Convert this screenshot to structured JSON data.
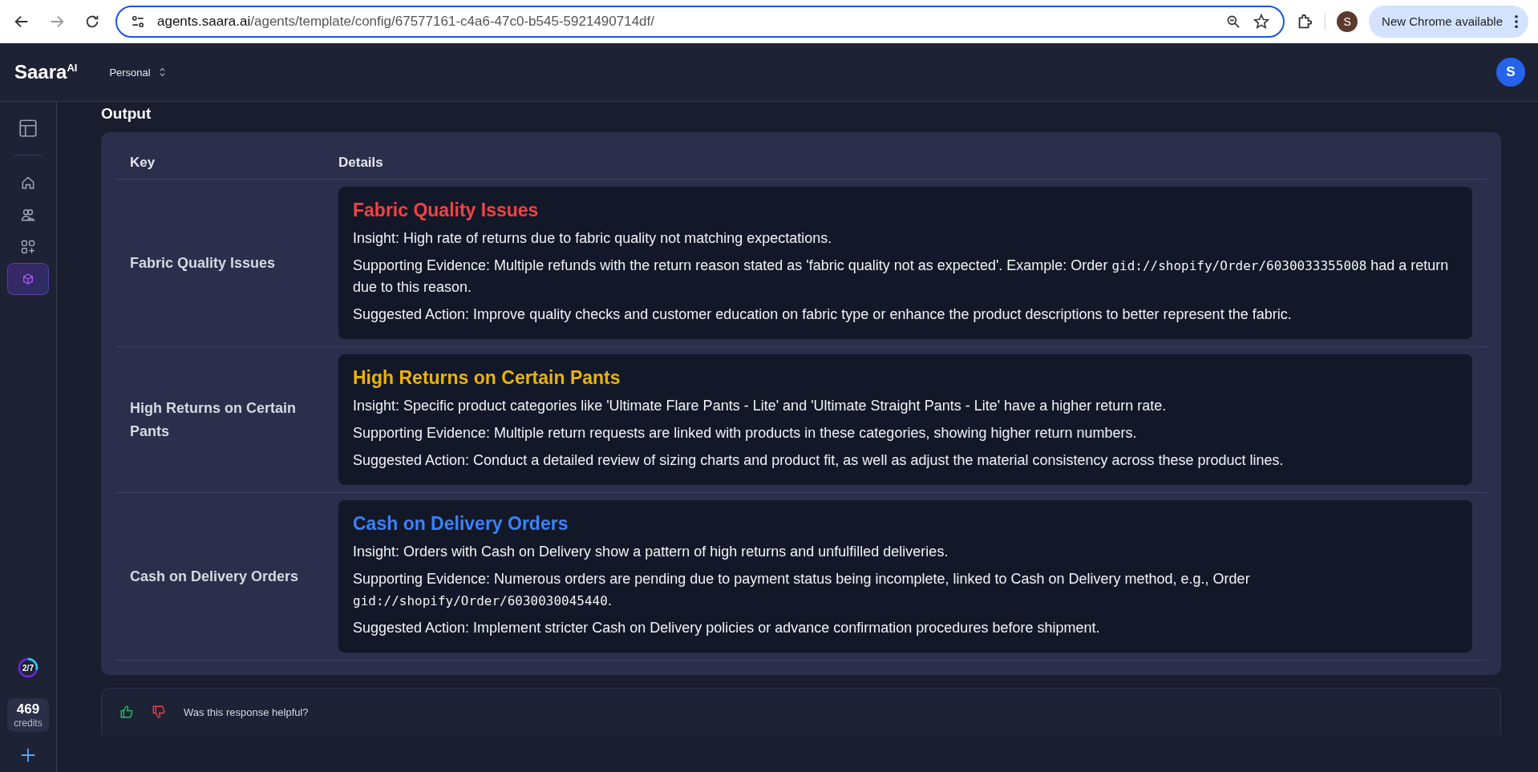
{
  "browser": {
    "url_host": "agents.saara.ai",
    "url_path": "/agents/template/config/67577161-c4a6-47c0-b545-5921490714df/",
    "profile_initial": "S",
    "update_label": "New Chrome available"
  },
  "header": {
    "logo": "Saara",
    "logo_sup": "AI",
    "workspace": "Personal",
    "avatar_initial": "S"
  },
  "sidebar": {
    "items": [
      {
        "kind": "home",
        "selected": false
      },
      {
        "kind": "people",
        "selected": false
      },
      {
        "kind": "apps",
        "selected": false
      },
      {
        "kind": "cube",
        "selected": true
      }
    ],
    "progress": {
      "label": "2/7",
      "level": 0.2857
    },
    "credits": {
      "count": "469",
      "label": "credits"
    }
  },
  "output": {
    "title": "Output",
    "columns": [
      "Key",
      "Details"
    ],
    "rows": [
      {
        "key": "Fabric Quality Issues",
        "title": "Fabric Quality Issues",
        "color": "#ef4444",
        "paragraphs": [
          [
            {
              "kind": "text",
              "text": "Insight: High rate of returns due to fabric quality not matching expectations."
            }
          ],
          [
            {
              "kind": "text",
              "text": "Supporting Evidence: Multiple refunds with the return reason stated as 'fabric quality not as expected'. Example: Order "
            },
            {
              "kind": "code",
              "text": "gid://shopify/Order/6030033355008"
            },
            {
              "kind": "text",
              "text": " had a return due to this reason."
            }
          ],
          [
            {
              "kind": "text",
              "text": "Suggested Action: Improve quality checks and customer education on fabric type or enhance the product descriptions to better represent the fabric."
            }
          ]
        ]
      },
      {
        "key": "High Returns on Certain Pants",
        "title": "High Returns on Certain Pants",
        "color": "#eab308",
        "paragraphs": [
          [
            {
              "kind": "text",
              "text": "Insight: Specific product categories like 'Ultimate Flare Pants - Lite' and 'Ultimate Straight Pants - Lite' have a higher return rate."
            }
          ],
          [
            {
              "kind": "text",
              "text": "Supporting Evidence: Multiple return requests are linked with products in these categories, showing higher return numbers."
            }
          ],
          [
            {
              "kind": "text",
              "text": "Suggested Action: Conduct a detailed review of sizing charts and product fit, as well as adjust the material consistency across these product lines."
            }
          ]
        ]
      },
      {
        "key": "Cash on Delivery Orders",
        "title": "Cash on Delivery Orders",
        "color": "#3b82f6",
        "paragraphs": [
          [
            {
              "kind": "text",
              "text": "Insight: Orders with Cash on Delivery show a pattern of high returns and unfulfilled deliveries."
            }
          ],
          [
            {
              "kind": "text",
              "text": "Supporting Evidence: Numerous orders are pending due to payment status being incomplete, linked to Cash on Delivery method, e.g., Order "
            },
            {
              "kind": "code",
              "text": "gid://shopify/Order/6030030045440"
            },
            {
              "kind": "text",
              "text": "."
            }
          ],
          [
            {
              "kind": "text",
              "text": "Suggested Action: Implement stricter Cash on Delivery policies or advance confirmation procedures before shipment."
            }
          ]
        ]
      }
    ]
  },
  "feedback": {
    "question": "Was this response helpful?"
  }
}
